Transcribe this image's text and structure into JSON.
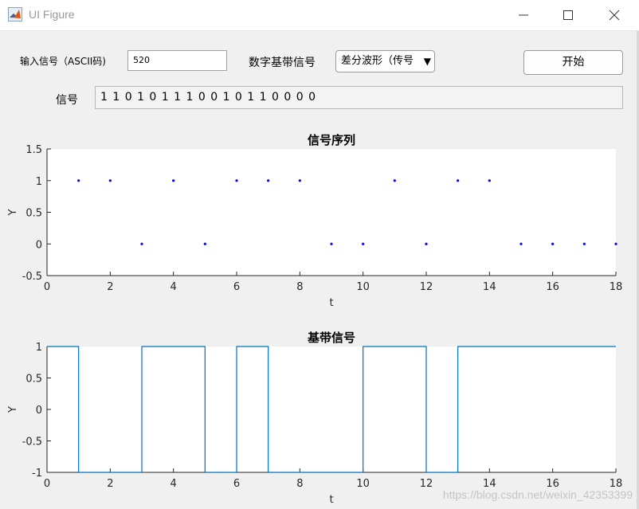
{
  "window": {
    "title": "UI Figure",
    "icon": "matlab-icon"
  },
  "controls": {
    "input_label": "输入信号（ASCII码)",
    "input_value": "520",
    "mod_label": "数字基带信号",
    "mod_selected": "差分波形（传号",
    "start_button": "开始",
    "signal_label": "信号",
    "signal_value": "1 1 0 1 0 1 1 1 0 0 1 0 1 1 0 0 0 0"
  },
  "colors": {
    "accent": "#0072bd",
    "dots": "#0000ff",
    "plot_bg": "#ffffff",
    "figure_bg": "#f0f0f0"
  },
  "chart_data": [
    {
      "type": "scatter",
      "title": "信号序列",
      "xlabel": "t",
      "ylabel": "Y",
      "xlim": [
        0,
        18
      ],
      "ylim": [
        -0.5,
        1.5
      ],
      "xticks": [
        "0",
        "2",
        "4",
        "6",
        "8",
        "10",
        "12",
        "14",
        "16",
        "18"
      ],
      "yticks": [
        "-0.5",
        "0",
        "0.5",
        "1",
        "1.5"
      ],
      "x": [
        1,
        2,
        3,
        4,
        5,
        6,
        7,
        8,
        9,
        10,
        11,
        12,
        13,
        14,
        15,
        16,
        17,
        18
      ],
      "y": [
        1,
        1,
        0,
        1,
        0,
        1,
        1,
        1,
        0,
        0,
        1,
        0,
        1,
        1,
        0,
        0,
        0,
        0
      ],
      "grid": false
    },
    {
      "type": "line",
      "title": "基带信号",
      "xlabel": "t",
      "ylabel": "Y",
      "xlim": [
        0,
        18
      ],
      "ylim": [
        -1,
        1
      ],
      "xticks": [
        "0",
        "2",
        "4",
        "6",
        "8",
        "10",
        "12",
        "14",
        "16",
        "18"
      ],
      "yticks": [
        "-1",
        "-0.5",
        "0",
        "0.5",
        "1"
      ],
      "step_levels": [
        1,
        -1,
        -1,
        1,
        1,
        -1,
        1,
        -1,
        -1,
        -1,
        1,
        1,
        -1,
        1,
        1,
        1,
        1,
        1
      ],
      "grid": false
    }
  ],
  "watermark": "https://blog.csdn.net/weixin_42353399"
}
